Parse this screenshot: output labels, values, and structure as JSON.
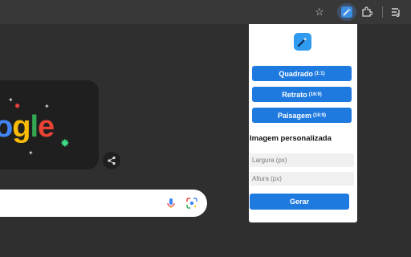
{
  "page": {
    "title": "Google"
  },
  "toolbar": {
    "icons": [
      "bookmark-star-icon",
      "extension-active-icon",
      "extensions-puzzle-icon",
      "reading-list-icon"
    ]
  },
  "doodle": {
    "text": "ogle",
    "colors": {
      "o": "#4285f4",
      "g": "#fbbc05",
      "l": "#34a853",
      "e": "#ea4335"
    }
  },
  "popup": {
    "presets": [
      {
        "label": "Quadrado",
        "ratio": "(1:1)"
      },
      {
        "label": "Retrato",
        "ratio": "(16:9)"
      },
      {
        "label": "Paisagem",
        "ratio": "(16:9)"
      }
    ],
    "custom_title": "Imagem personalizada",
    "width_placeholder": "Largura (px)",
    "height_placeholder": "Altura (px)",
    "generate_label": "Gerar"
  },
  "colors": {
    "accent": "#1f7ae0",
    "logo": "#2e9bf0",
    "dark_bg": "#2f2f2f"
  }
}
